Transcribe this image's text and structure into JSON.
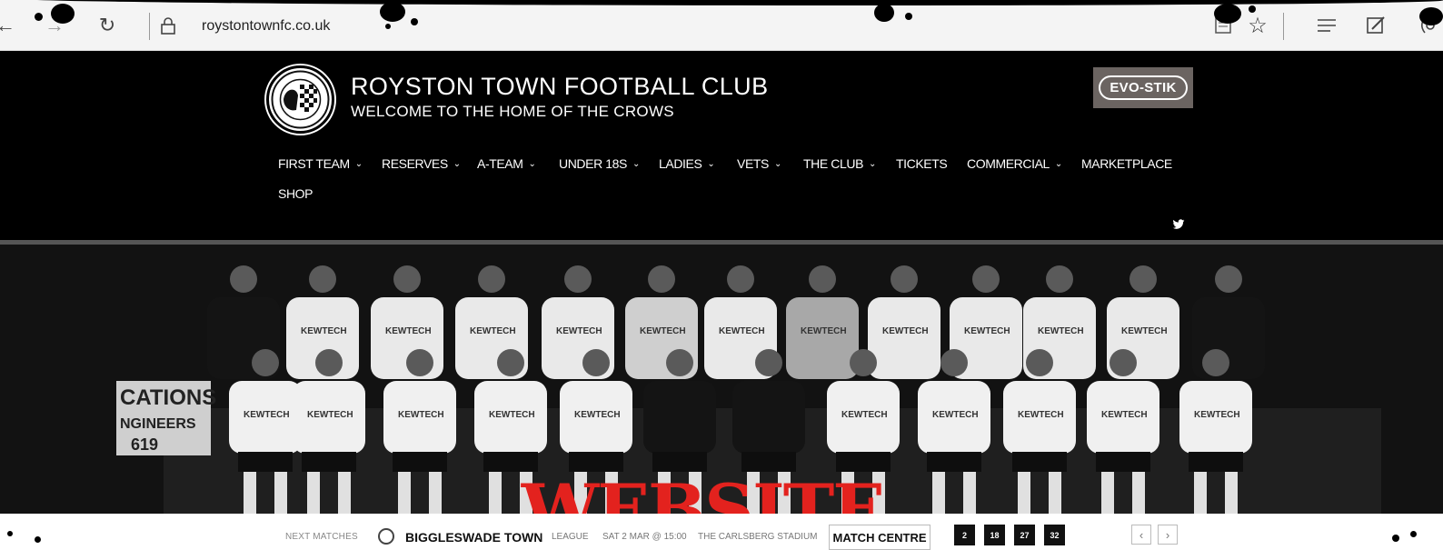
{
  "browser": {
    "url": "roystontownfc.co.uk",
    "icons": [
      "back-arrow-icon",
      "forward-arrow-icon",
      "refresh-icon",
      "lock-icon",
      "reading-view-icon",
      "favorite-star-icon",
      "hub-icon",
      "web-note-icon",
      "share-icon"
    ]
  },
  "header": {
    "club_name": "ROYSTON TOWN FOOTBALL CLUB",
    "tagline": "WELCOME TO THE HOME OF THE CROWS",
    "sponsor": "EVO-STIK"
  },
  "nav": {
    "items": [
      {
        "label": "FIRST TEAM",
        "dropdown": true
      },
      {
        "label": "RESERVES",
        "dropdown": true
      },
      {
        "label": "A-TEAM",
        "dropdown": true
      },
      {
        "label": "UNDER 18S",
        "dropdown": true
      },
      {
        "label": "LADIES",
        "dropdown": true
      },
      {
        "label": "VETS",
        "dropdown": true
      },
      {
        "label": "THE CLUB",
        "dropdown": true
      },
      {
        "label": "TICKETS",
        "dropdown": false
      },
      {
        "label": "COMMERCIAL",
        "dropdown": true
      },
      {
        "label": "MARKETPLACE",
        "dropdown": false
      },
      {
        "label": "SHOP",
        "dropdown": false
      }
    ],
    "chevron": "⌄",
    "social_icon": "twitter-icon"
  },
  "hero": {
    "stamp": "WEBSITE",
    "stamp_color": "#e3221e",
    "sign_lines": [
      "CATIONS",
      "NGINEERS",
      "619"
    ],
    "shirt_sponsor": "KEWTECH"
  },
  "matches": {
    "label": "NEXT MATCHES",
    "team": "BIGGLESWADE TOWN",
    "type": "LEAGUE",
    "date": "SAT 2 MAR @ 15:00",
    "venue": "THE CARLSBERG STADIUM",
    "centre_label": "MATCH CENTRE",
    "pages": [
      "2",
      "18",
      "27",
      "32"
    ],
    "prev": "‹",
    "next": "›"
  }
}
